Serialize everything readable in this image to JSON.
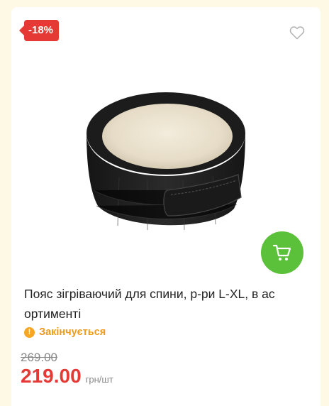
{
  "product": {
    "discount": "-18%",
    "title": "Пояс зігріваючий для спини, р-ри L-XL, в ас ортименті",
    "stock_status": "Закінчується",
    "old_price": "269.00",
    "price": "219.00",
    "unit": "грн/шт"
  },
  "icons": {
    "wishlist": "heart-outline-icon",
    "cart": "shopping-cart-icon",
    "status": "exclamation-circle-icon"
  },
  "colors": {
    "discount_badge": "#e53935",
    "cart_button": "#5cc13a",
    "stock_status": "#f09a1a",
    "price": "#e53935",
    "background": "#fdf9e4"
  }
}
